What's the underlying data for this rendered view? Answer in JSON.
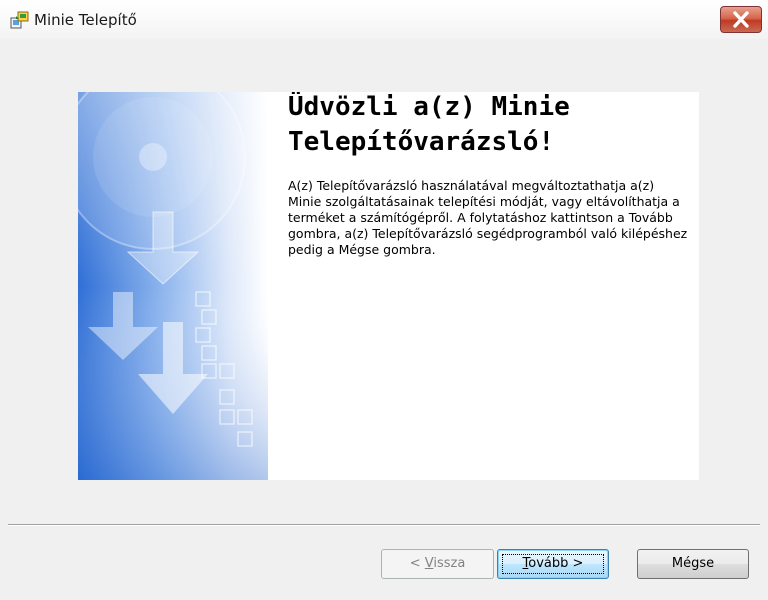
{
  "window": {
    "title": "Minie Telepítő",
    "close_icon": "close-icon"
  },
  "welcome": {
    "title_line1": "Üdvözli a(z) Minie",
    "title_line2": "Telepítővarázsló!",
    "body": [
      "A(z) Telepítővarázsló használatával megváltoztathatja a(z)",
      "Minie szolgáltatásainak telepítési módját, vagy eltávolíthatja a",
      "terméket a számítógépről. A folytatáshoz kattintson a Tovább",
      "gombra, a(z) Telepítővarázsló segédprogramból való kilépéshez",
      "pedig a Mégse gombra."
    ]
  },
  "buttons": {
    "back": {
      "prefix": "< ",
      "access": "V",
      "rest": "issza",
      "enabled": false
    },
    "next": {
      "access": "T",
      "rest": "ovább >",
      "default": true
    },
    "cancel": {
      "label": "Mégse"
    }
  },
  "colors": {
    "art_blue": "#2f6fd6",
    "close_red": "#c9442c",
    "default_button_border": "#3c7fb1"
  }
}
